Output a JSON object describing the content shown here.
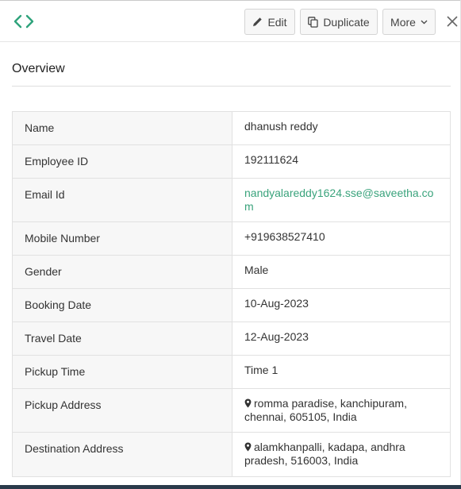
{
  "toolbar": {
    "edit_label": "Edit",
    "duplicate_label": "Duplicate",
    "more_label": "More",
    "brand_color": "#2fa37c"
  },
  "overview": {
    "title": "Overview"
  },
  "details": [
    {
      "label": "Name",
      "value": "dhanush reddy"
    },
    {
      "label": "Employee ID",
      "value": "192111624"
    },
    {
      "label": "Email Id",
      "value": "nandyalareddy1624.sse@saveetha.com"
    },
    {
      "label": "Mobile Number",
      "value": "+919638527410"
    },
    {
      "label": "Gender",
      "value": "Male"
    },
    {
      "label": "Booking Date",
      "value": "10-Aug-2023"
    },
    {
      "label": "Travel Date",
      "value": "12-Aug-2023"
    },
    {
      "label": "Pickup Time",
      "value": "Time 1"
    },
    {
      "label": "Pickup Address",
      "value": "romma paradise, kanchipuram, chennai, 605105, India"
    },
    {
      "label": "Destination Address",
      "value": "alamkhanpalli, kadapa, andhra pradesh, 516003, India"
    }
  ],
  "icons": {
    "code": "code-icon",
    "edit": "pencil-icon",
    "duplicate": "copy-icon",
    "more": "chevron-down-icon",
    "close": "close-icon",
    "location": "map-pin-icon"
  }
}
